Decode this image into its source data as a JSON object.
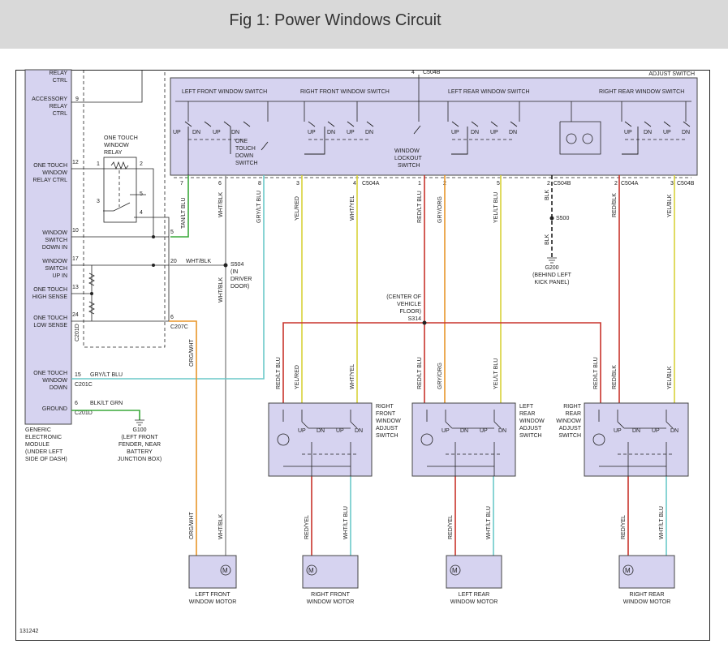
{
  "header": {
    "title": "Fig 1: Power Windows Circuit"
  },
  "figure_id": "131242",
  "gem": {
    "name_lines": [
      "GENERIC",
      "ELECTRONIC",
      "MODULE",
      "(UNDER LEFT",
      "SIDE OF DASH)"
    ],
    "pins": [
      {
        "label": [
          "RELAY",
          "CTRL"
        ],
        "pin": ""
      },
      {
        "label": [
          "ACCESSORY",
          "RELAY",
          "CTRL"
        ],
        "pin": "9"
      },
      {
        "label": [
          "ONE TOUCH",
          "WINDOW",
          "RELAY CTRL"
        ],
        "pin": "12"
      },
      {
        "label": [
          "WINDOW",
          "SWITCH",
          "DOWN IN"
        ],
        "pin": "10"
      },
      {
        "label": [
          "WINDOW",
          "SWITCH",
          "UP IN"
        ],
        "pin": "17"
      },
      {
        "label": [
          "ONE TOUCH",
          "HIGH SENSE"
        ],
        "pin": "13"
      },
      {
        "label": [
          "ONE TOUCH",
          "LOW SENSE"
        ],
        "pin": "24"
      },
      {
        "label": [
          "ONE TOUCH",
          "WINDOW",
          "DOWN"
        ],
        "pin": "15"
      },
      {
        "label": [
          "GROUND"
        ],
        "pin": "6"
      }
    ],
    "connectors": {
      "c201d": "C201D",
      "c201c": "C201C",
      "c201d_b": "C201D",
      "c207c": "C207C"
    }
  },
  "relay": {
    "label_lines": [
      "ONE TOUCH",
      "WINDOW",
      "RELAY"
    ],
    "pins": [
      "1",
      "2",
      "3",
      "4",
      "5"
    ]
  },
  "adjust_switch": {
    "title": "ADJUST SWITCH",
    "connector_top": "C504B",
    "top_pin": "4",
    "sections": [
      "LEFT FRONT WINDOW SWITCH",
      "RIGHT FRONT WINDOW SWITCH",
      "LEFT REAR WINDOW SWITCH",
      "RIGHT REAR WINDOW SWITCH"
    ],
    "one_touch_label": [
      "ONE",
      "TOUCH",
      "DOWN",
      "SWITCH"
    ],
    "lockout_label": [
      "WINDOW",
      "LOCKOUT",
      "SWITCH"
    ],
    "up": "UP",
    "dn": "DN",
    "connectors": {
      "c504a": "C504A",
      "c504b": "C504B",
      "c504a_2": "C504A",
      "c504b_2": "C504B"
    },
    "pins": [
      "7",
      "6",
      "8",
      "3",
      "4",
      "1",
      "2",
      "5",
      "2",
      "2",
      "3"
    ]
  },
  "wires": {
    "tan_lt_blu": "TAN/LT BLU",
    "wht_blk": "WHT/BLK",
    "gry_lt_blu": "GRY/LT BLU",
    "yel_red": "YEL/RED",
    "wht_yel": "WHT/YEL",
    "red_lt_blu": "RED/LT BLU",
    "gry_org": "GRY/ORG",
    "yel_lt_blu": "YEL/LT BLU",
    "blk": "BLK",
    "red_blk": "RED/BLK",
    "yel_blk": "YEL/BLK",
    "org_wht": "ORG/WHT",
    "red_yel": "RED/YEL",
    "wht_lt_blu": "WHT/LT BLU",
    "blk_lt_grn": "BLK/LT GRN",
    "wht_blk_20": "WHT/BLK",
    "gry_lt_blu_15": "GRY/LT BLU"
  },
  "splices": {
    "s504": [
      "S504",
      "(IN",
      "DRIVER",
      "DOOR)"
    ],
    "s500": "S500",
    "s314": [
      "(CENTER OF",
      "VEHICLE",
      "FLOOR)",
      "S314"
    ],
    "g200": [
      "G200",
      "(BEHIND LEFT",
      "KICK PANEL)"
    ],
    "g100": [
      "G100",
      "(LEFT FRONT",
      "FENDER, NEAR",
      "BATTERY",
      "JUNCTION BOX)"
    ]
  },
  "door_switches": [
    {
      "name": [
        "RIGHT",
        "FRONT",
        "WINDOW",
        "ADJUST",
        "SWITCH"
      ]
    },
    {
      "name": [
        "LEFT",
        "REAR",
        "WINDOW",
        "ADJUST",
        "SWITCH"
      ]
    },
    {
      "name": [
        "RIGHT",
        "REAR",
        "WINDOW",
        "ADJUST",
        "SWITCH"
      ]
    }
  ],
  "motors": [
    {
      "name": [
        "LEFT FRONT",
        "WINDOW MOTOR"
      ]
    },
    {
      "name": [
        "RIGHT FRONT",
        "WINDOW MOTOR"
      ]
    },
    {
      "name": [
        "LEFT REAR",
        "WINDOW MOTOR"
      ]
    },
    {
      "name": [
        "RIGHT REAR",
        "WINDOW MOTOR"
      ]
    }
  ],
  "colors": {
    "box_fill": "#d6d3f0",
    "orange": "#e8962a",
    "red": "#c8332b",
    "gray": "#9a9a9a",
    "yellow": "#d9d23a",
    "cyan": "#6cc9c9",
    "green": "#3aa83a",
    "black": "#222222"
  }
}
